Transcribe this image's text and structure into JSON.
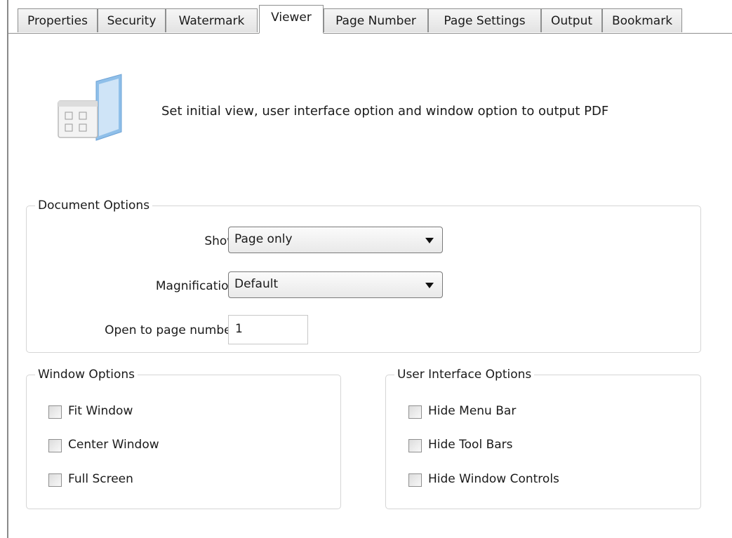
{
  "tabs": [
    {
      "label": "Properties",
      "active": false
    },
    {
      "label": "Security",
      "active": false
    },
    {
      "label": "Watermark",
      "active": false
    },
    {
      "label": "Viewer",
      "active": true
    },
    {
      "label": "Page Number",
      "active": false
    },
    {
      "label": "Page Settings",
      "active": false
    },
    {
      "label": "Output",
      "active": false
    },
    {
      "label": "Bookmark",
      "active": false
    }
  ],
  "header": {
    "icon": "viewer-window-icon",
    "description": "Set initial view, user interface option and window option to output PDF"
  },
  "document_options": {
    "title": "Document Options",
    "show_label": "Show:",
    "show_value": "Page only",
    "magnification_label": "Magnification:",
    "magnification_value": "Default",
    "open_page_label": "Open to page number:",
    "open_page_value": "1"
  },
  "window_options": {
    "title": "Window Options",
    "items": [
      {
        "label": "Fit Window",
        "checked": false
      },
      {
        "label": "Center Window",
        "checked": false
      },
      {
        "label": "Full Screen",
        "checked": false
      }
    ]
  },
  "ui_options": {
    "title": "User Interface Options",
    "items": [
      {
        "label": "Hide Menu Bar",
        "checked": false
      },
      {
        "label": "Hide Tool Bars",
        "checked": false
      },
      {
        "label": "Hide Window Controls",
        "checked": false
      }
    ]
  },
  "colors": {
    "border": "#8e8f8f",
    "group_border": "#d5d5d5",
    "icon_blue": "#7fb2e6"
  }
}
